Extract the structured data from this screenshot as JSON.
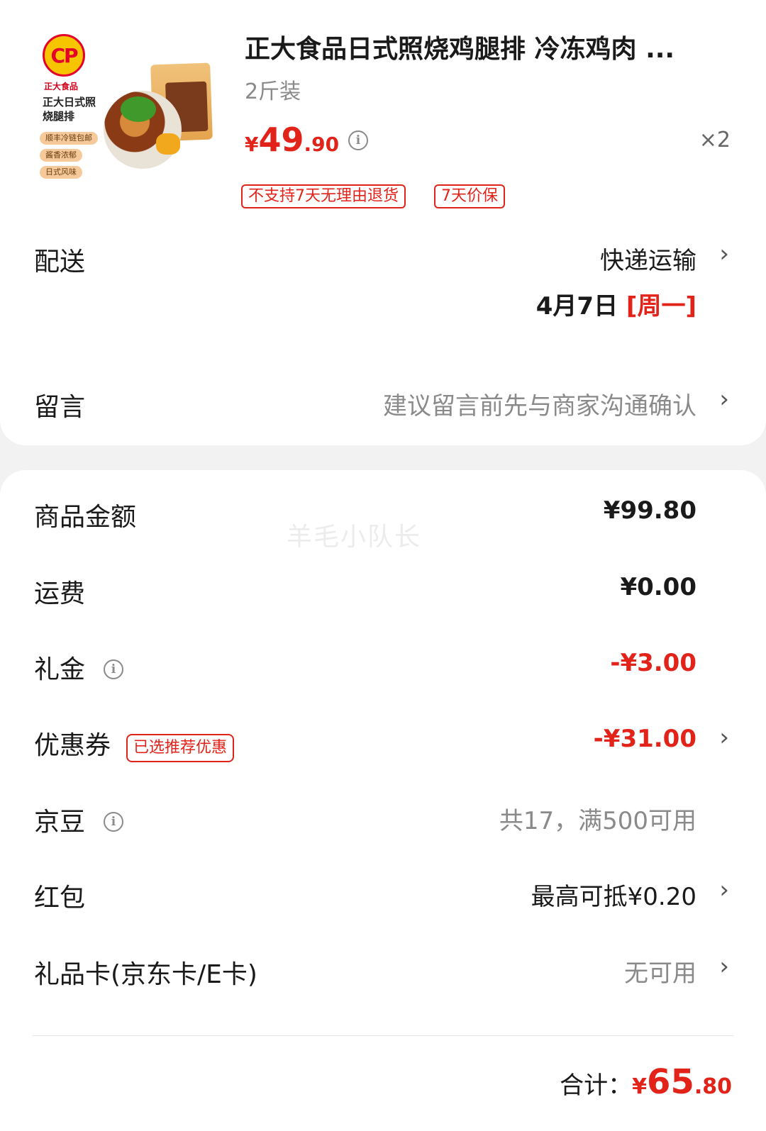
{
  "product": {
    "title": "正大食品日式照烧鸡腿排 冷冻鸡肉 ...",
    "spec": "2斤装",
    "price_currency": "¥",
    "price_int": "49",
    "price_dec": ".90",
    "quantity": "×2",
    "tags": [
      "不支持7天无理由退货",
      "7天价保"
    ],
    "image": {
      "brand_logo": "CP",
      "brand_name": "正大食品",
      "title": "正大日式照烧腿排",
      "pills": [
        "顺丰冷链包邮",
        "酱香浓郁",
        "日式风味"
      ]
    }
  },
  "delivery": {
    "label": "配送",
    "method": "快递运输",
    "date": "4月7日",
    "weekday": "[周一]"
  },
  "message": {
    "label": "留言",
    "placeholder": "建议留言前先与商家沟通确认"
  },
  "watermark": "羊毛小队长",
  "summary": {
    "goods_amount": {
      "label": "商品金额",
      "value": "¥99.80"
    },
    "shipping": {
      "label": "运费",
      "value": "¥0.00"
    },
    "gift_money": {
      "label": "礼金",
      "value": "-¥3.00"
    },
    "coupon": {
      "label": "优惠券",
      "badge": "已选推荐优惠",
      "value": "-¥31.00"
    },
    "jingdou": {
      "label": "京豆",
      "value": "共17，满500可用"
    },
    "red_packet": {
      "label": "红包",
      "value": "最高可抵¥0.20"
    },
    "gift_card": {
      "label": "礼品卡(京东卡/E卡)",
      "value": "无可用"
    }
  },
  "total": {
    "label": "合计：",
    "currency": "¥",
    "int": "65",
    "dec": ".80"
  },
  "colors": {
    "accent_red": "#e2231a",
    "gray_text": "#8a8a8a",
    "background": "#f2f2f2"
  },
  "icons": {
    "info": "info-circle-icon",
    "chevron": "chevron-right-icon"
  }
}
